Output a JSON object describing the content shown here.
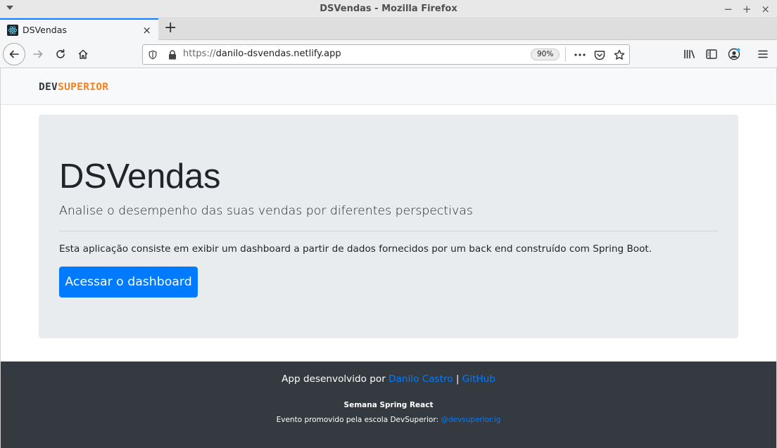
{
  "window": {
    "title": "DSVendas - Mozilla Firefox",
    "minimize": "−",
    "maximize": "+",
    "close": "×"
  },
  "tab": {
    "title": "DSVendas",
    "close": "×",
    "new_tab": "+"
  },
  "urlbar": {
    "protocol": "https://",
    "host": "danilo-dsvendas.netlify.app",
    "zoom": "90%"
  },
  "site": {
    "logo_dev": "DEV",
    "logo_superior": "SUPERIOR",
    "title": "DSVendas",
    "lead": "Analise o desempenho das suas vendas por diferentes perspectivas",
    "description": "Esta aplicação consiste em exibir um dashboard a partir de dados fornecidos por um back end construído com Spring Boot.",
    "cta_label": "Acessar o dashboard"
  },
  "footer": {
    "developed_by": "App desenvolvido por ",
    "author_link": "Danilo Castro",
    "separator": " | ",
    "github_link": "GitHub",
    "event_title": "Semana Spring React",
    "event_text": "Evento promovido pela escola DevSuperior: ",
    "instagram_link": "@devsuperior.ig"
  },
  "colors": {
    "primary": "#007bff",
    "logo_accent": "#f58220",
    "footer_bg": "#343a40",
    "jumbotron_bg": "#e9ecef",
    "tab_accent": "#0a84ff"
  }
}
